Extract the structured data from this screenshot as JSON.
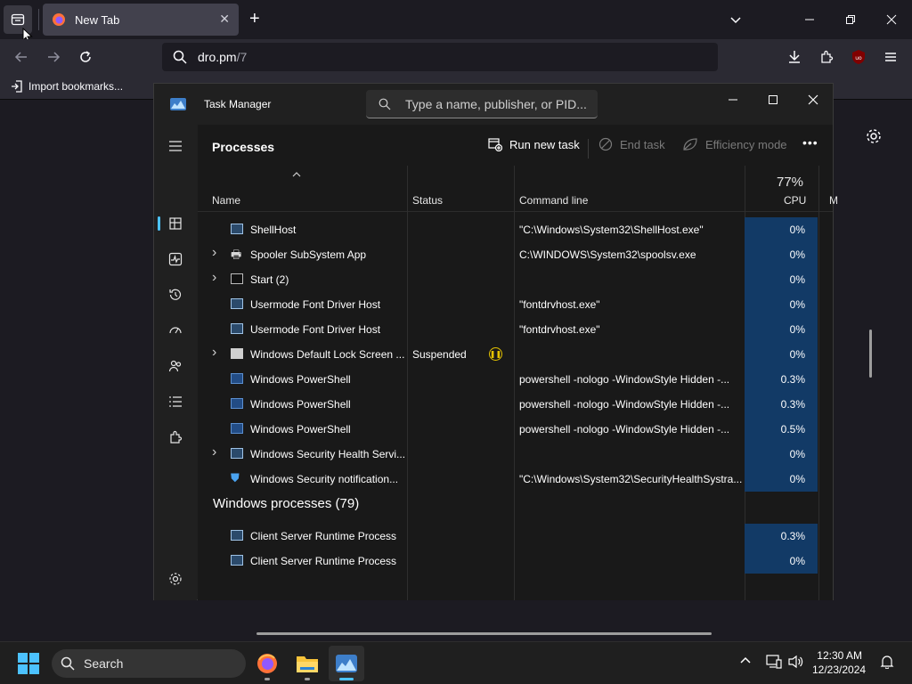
{
  "browser": {
    "tab_title": "New Tab",
    "url_host": "dro.pm",
    "url_path": "/7",
    "bookmark_label": "Import bookmarks...",
    "new_tab_symbol": "+",
    "tab_close_symbol": "✕"
  },
  "task_manager": {
    "title": "Task Manager",
    "search_placeholder": "Type a name, publisher, or PID...",
    "section_title": "Processes",
    "commands": {
      "run_new_task": "Run new task",
      "end_task": "End task",
      "efficiency_mode": "Efficiency mode",
      "more": "•••"
    },
    "columns": {
      "name": "Name",
      "status": "Status",
      "command_line": "Command line",
      "cpu_percent": "77%",
      "cpu": "CPU",
      "memory_abbrev": "M"
    },
    "rows": [
      {
        "name": "ShellHost",
        "status": "",
        "cmd": "\"C:\\Windows\\System32\\ShellHost.exe\"",
        "cpu": "0%",
        "expandable": false,
        "icon": "window"
      },
      {
        "name": "Spooler SubSystem App",
        "status": "",
        "cmd": "C:\\WINDOWS\\System32\\spoolsv.exe",
        "cpu": "0%",
        "expandable": true,
        "icon": "printer"
      },
      {
        "name": "Start (2)",
        "status": "",
        "cmd": "",
        "cpu": "0%",
        "expandable": true,
        "icon": "start"
      },
      {
        "name": "Usermode Font Driver Host",
        "status": "",
        "cmd": "\"fontdrvhost.exe\"",
        "cpu": "0%",
        "expandable": false,
        "icon": "window"
      },
      {
        "name": "Usermode Font Driver Host",
        "status": "",
        "cmd": "\"fontdrvhost.exe\"",
        "cpu": "0%",
        "expandable": false,
        "icon": "window"
      },
      {
        "name": "Windows Default Lock Screen ...",
        "status": "Suspended",
        "cmd": "",
        "cpu": "0%",
        "expandable": true,
        "icon": "gray"
      },
      {
        "name": "Windows PowerShell",
        "status": "",
        "cmd": "powershell  -nologo -WindowStyle Hidden -...",
        "cpu": "0.3%",
        "expandable": false,
        "icon": "ps"
      },
      {
        "name": "Windows PowerShell",
        "status": "",
        "cmd": "powershell  -nologo -WindowStyle Hidden -...",
        "cpu": "0.3%",
        "expandable": false,
        "icon": "ps"
      },
      {
        "name": "Windows PowerShell",
        "status": "",
        "cmd": "powershell  -nologo -WindowStyle Hidden -...",
        "cpu": "0.5%",
        "expandable": false,
        "icon": "ps"
      },
      {
        "name": "Windows Security Health Servi...",
        "status": "",
        "cmd": "",
        "cpu": "0%",
        "expandable": true,
        "icon": "window"
      },
      {
        "name": "Windows Security notification...",
        "status": "",
        "cmd": "\"C:\\Windows\\System32\\SecurityHealthSystra...",
        "cpu": "0%",
        "expandable": false,
        "icon": "shield"
      }
    ],
    "group_header": "Windows processes (79)",
    "rows_after": [
      {
        "name": "Client Server Runtime Process",
        "status": "",
        "cmd": "",
        "cpu": "0.3%",
        "expandable": false,
        "icon": "window"
      },
      {
        "name": "Client Server Runtime Process",
        "status": "",
        "cmd": "",
        "cpu": "0%",
        "expandable": false,
        "icon": "window"
      }
    ]
  },
  "taskbar": {
    "search_label": "Search",
    "time": "12:30 AM",
    "date": "12/23/2024"
  },
  "colors": {
    "accent": "#4cc2ff",
    "cpu_highlight": "#123a66",
    "suspended": "#e4c200"
  }
}
